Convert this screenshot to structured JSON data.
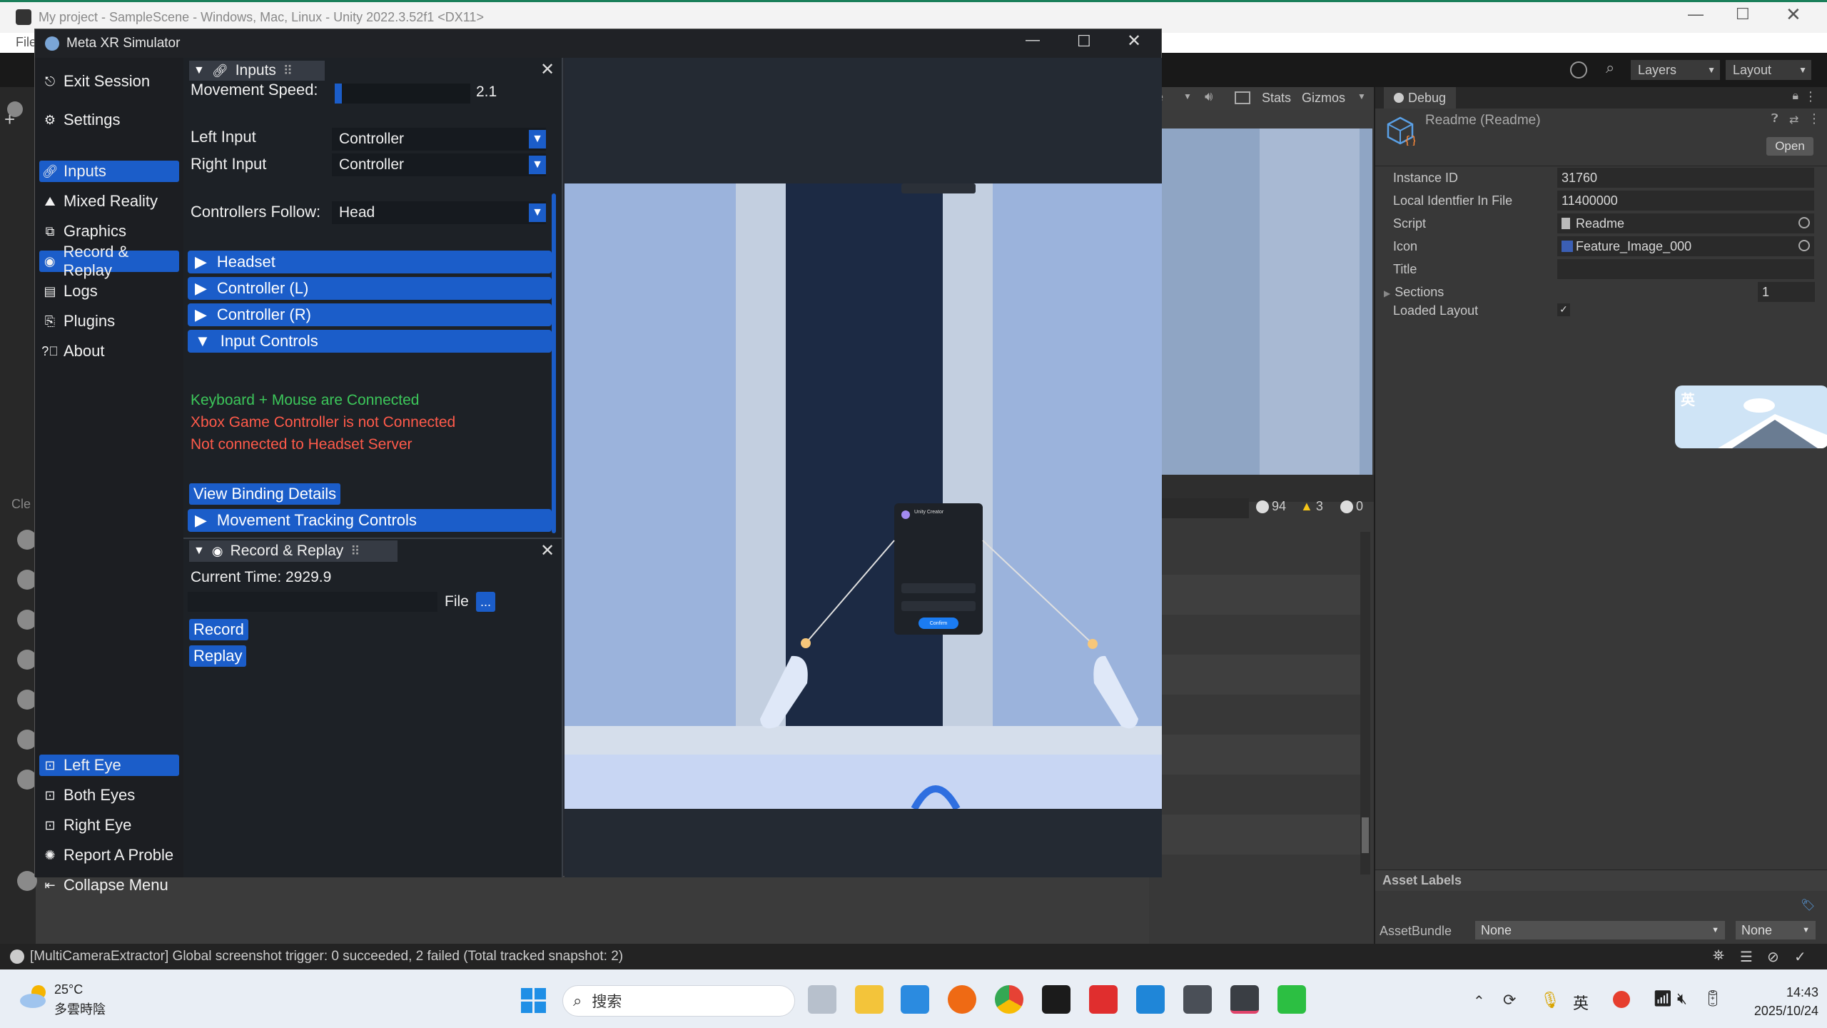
{
  "unity": {
    "title": "My project - SampleScene - Windows, Mac, Linux - Unity 2022.3.52f1 <DX11>",
    "menu_file": "File",
    "toolbar": {
      "layers": "Layers",
      "layout": "Layout"
    },
    "scene_bar": {
      "stats": "Stats",
      "gizmos": "Gizmos",
      "trunc": "e"
    },
    "console": {
      "clear": "Cle",
      "errors": "94",
      "warnings": "3",
      "infos": "0"
    },
    "status": "[MultiCameraExtractor] Global screenshot trigger: 0 succeeded, 2 failed (Total tracked snapshot: 2)"
  },
  "inspector": {
    "tab": "Debug",
    "object": "Readme (Readme)",
    "open_button": "Open",
    "rows": [
      {
        "label": "Instance ID",
        "value": "31760"
      },
      {
        "label": "Local Identfier In File",
        "value": "11400000"
      },
      {
        "label": "Script",
        "value": "Readme"
      },
      {
        "label": "Icon",
        "value": "Feature_Image_000"
      },
      {
        "label": "Title",
        "value": ""
      },
      {
        "label": "Sections",
        "value": "1"
      },
      {
        "label": "Loaded Layout",
        "value": ""
      }
    ],
    "asset_labels": "Asset Labels",
    "asset_bundle": "AssetBundle",
    "bundle_value": "None",
    "bundle_variant": "None",
    "ime_badge": "英"
  },
  "meta": {
    "title": "Meta XR Simulator",
    "sidebar": [
      {
        "label": "Exit Session",
        "icon": "exit-icon"
      },
      {
        "label": "Settings",
        "icon": "gear-icon"
      },
      {
        "label": "Inputs",
        "icon": "link-icon",
        "selected": true
      },
      {
        "label": "Mixed Reality",
        "icon": "mixed-reality-icon"
      },
      {
        "label": "Graphics",
        "icon": "graphics-icon"
      },
      {
        "label": "Record & Replay",
        "icon": "record-icon"
      },
      {
        "label": "Logs",
        "icon": "logs-icon"
      },
      {
        "label": "Plugins",
        "icon": "plugins-icon"
      },
      {
        "label": "About",
        "icon": "help-icon"
      }
    ],
    "eyes": [
      {
        "label": "Left Eye",
        "selected": true
      },
      {
        "label": "Both Eyes"
      },
      {
        "label": "Right Eye"
      }
    ],
    "report": "Report A Proble",
    "collapse": "Collapse Menu",
    "inputs": {
      "header": "Inputs",
      "movement_speed_label": "Movement Speed:",
      "movement_speed": "2.1",
      "left_input_label": "Left Input",
      "left_input": "Controller",
      "right_input_label": "Right Input",
      "right_input": "Controller",
      "follow_label": "Controllers Follow:",
      "follow": "Head",
      "sections": [
        "Headset",
        "Controller (L)",
        "Controller (R)",
        "Input Controls"
      ],
      "status_ok": "Keyboard + Mouse are Connected",
      "status_err1": "Xbox Game Controller is not Connected",
      "status_err2": "Not connected to Headset Server",
      "binding_button": "View Binding Details",
      "movement_tracking": "Movement Tracking Controls"
    },
    "record": {
      "header": "Record & Replay",
      "current_time": "Current Time: 2929.9",
      "file_label": "File",
      "file_button": "...",
      "record_button": "Record",
      "replay_button": "Replay"
    },
    "dialog": {
      "title": "Unity Creator",
      "confirm": "Confirm"
    }
  },
  "taskbar": {
    "temp": "25°C",
    "weather": "多雲時陰",
    "search": "搜索",
    "ime": "英",
    "time": "14:43",
    "date": "2025/10/24"
  },
  "colors": {
    "accent": "#1b5dc9",
    "ok": "#3cc65a",
    "error": "#ff5a4a"
  }
}
